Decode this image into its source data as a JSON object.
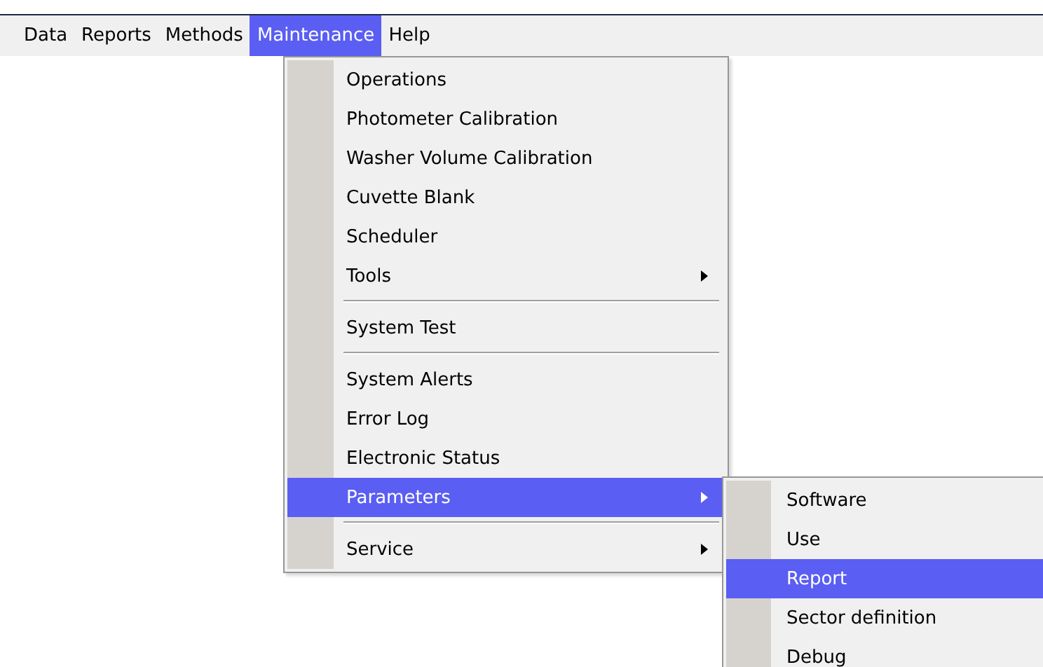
{
  "menubar": [
    {
      "label": "Data",
      "selected": false
    },
    {
      "label": "Reports",
      "selected": false
    },
    {
      "label": "Methods",
      "selected": false
    },
    {
      "label": "Maintenance",
      "selected": true
    },
    {
      "label": "Help",
      "selected": false
    }
  ],
  "menu": {
    "items": [
      {
        "kind": "item",
        "label": "Operations",
        "selected": false,
        "submenu": false
      },
      {
        "kind": "item",
        "label": "Photometer Calibration",
        "selected": false,
        "submenu": false
      },
      {
        "kind": "item",
        "label": "Washer Volume Calibration",
        "selected": false,
        "submenu": false
      },
      {
        "kind": "item",
        "label": "Cuvette Blank",
        "selected": false,
        "submenu": false
      },
      {
        "kind": "item",
        "label": "Scheduler",
        "selected": false,
        "submenu": false
      },
      {
        "kind": "item",
        "label": "Tools",
        "selected": false,
        "submenu": true
      },
      {
        "kind": "separator"
      },
      {
        "kind": "item",
        "label": "System Test",
        "selected": false,
        "submenu": false
      },
      {
        "kind": "separator"
      },
      {
        "kind": "item",
        "label": "System Alerts",
        "selected": false,
        "submenu": false
      },
      {
        "kind": "item",
        "label": "Error Log",
        "selected": false,
        "submenu": false
      },
      {
        "kind": "item",
        "label": "Electronic Status",
        "selected": false,
        "submenu": false
      },
      {
        "kind": "item",
        "label": "Parameters",
        "selected": true,
        "submenu": true
      },
      {
        "kind": "separator"
      },
      {
        "kind": "item",
        "label": "Service",
        "selected": false,
        "submenu": true
      }
    ]
  },
  "submenu": {
    "items": [
      {
        "kind": "item",
        "label": "Software",
        "selected": false,
        "submenu": false
      },
      {
        "kind": "item",
        "label": "Use",
        "selected": false,
        "submenu": false
      },
      {
        "kind": "item",
        "label": "Report",
        "selected": true,
        "submenu": false
      },
      {
        "kind": "item",
        "label": "Sector definition",
        "selected": false,
        "submenu": false
      },
      {
        "kind": "item",
        "label": "Debug",
        "selected": false,
        "submenu": false
      }
    ]
  }
}
